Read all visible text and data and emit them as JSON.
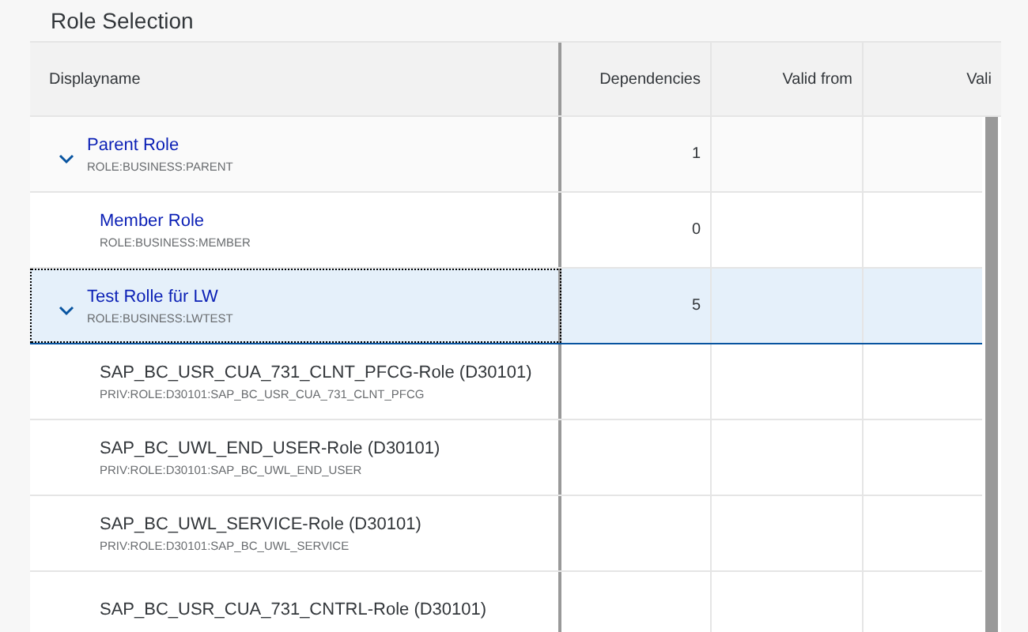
{
  "title": "Role Selection",
  "table": {
    "columns": [
      {
        "label": "Displayname"
      },
      {
        "label": "Dependencies"
      },
      {
        "label": "Valid from"
      },
      {
        "label": "Vali"
      }
    ],
    "rows": [
      {
        "kind": "link",
        "name": "Parent Role",
        "technical_name": "ROLE:BUSINESS:PARENT",
        "dependencies": "1",
        "expanded": true,
        "selected": false,
        "children": [
          {
            "kind": "link",
            "name": "Member Role",
            "technical_name": "ROLE:BUSINESS:MEMBER",
            "dependencies": "0",
            "selected": false
          }
        ]
      },
      {
        "kind": "link",
        "name": "Test Rolle für LW",
        "technical_name": "ROLE:BUSINESS:LWTEST",
        "dependencies": "5",
        "expanded": true,
        "selected": true,
        "children": [
          {
            "kind": "plain",
            "name": "SAP_BC_USR_CUA_731_CLNT_PFCG-Role (D30101)",
            "technical_name": "PRIV:ROLE:D30101:SAP_BC_USR_CUA_731_CLNT_PFCG",
            "selected": false
          },
          {
            "kind": "plain",
            "name": "SAP_BC_UWL_END_USER-Role (D30101)",
            "technical_name": "PRIV:ROLE:D30101:SAP_BC_UWL_END_USER",
            "selected": false
          },
          {
            "kind": "plain",
            "name": "SAP_BC_UWL_SERVICE-Role (D30101)",
            "technical_name": "PRIV:ROLE:D30101:SAP_BC_UWL_SERVICE",
            "selected": false
          },
          {
            "kind": "plain",
            "name": "SAP_BC_USR_CUA_731_CNTRL-Role (D30101)",
            "selected": false
          }
        ]
      }
    ]
  }
}
